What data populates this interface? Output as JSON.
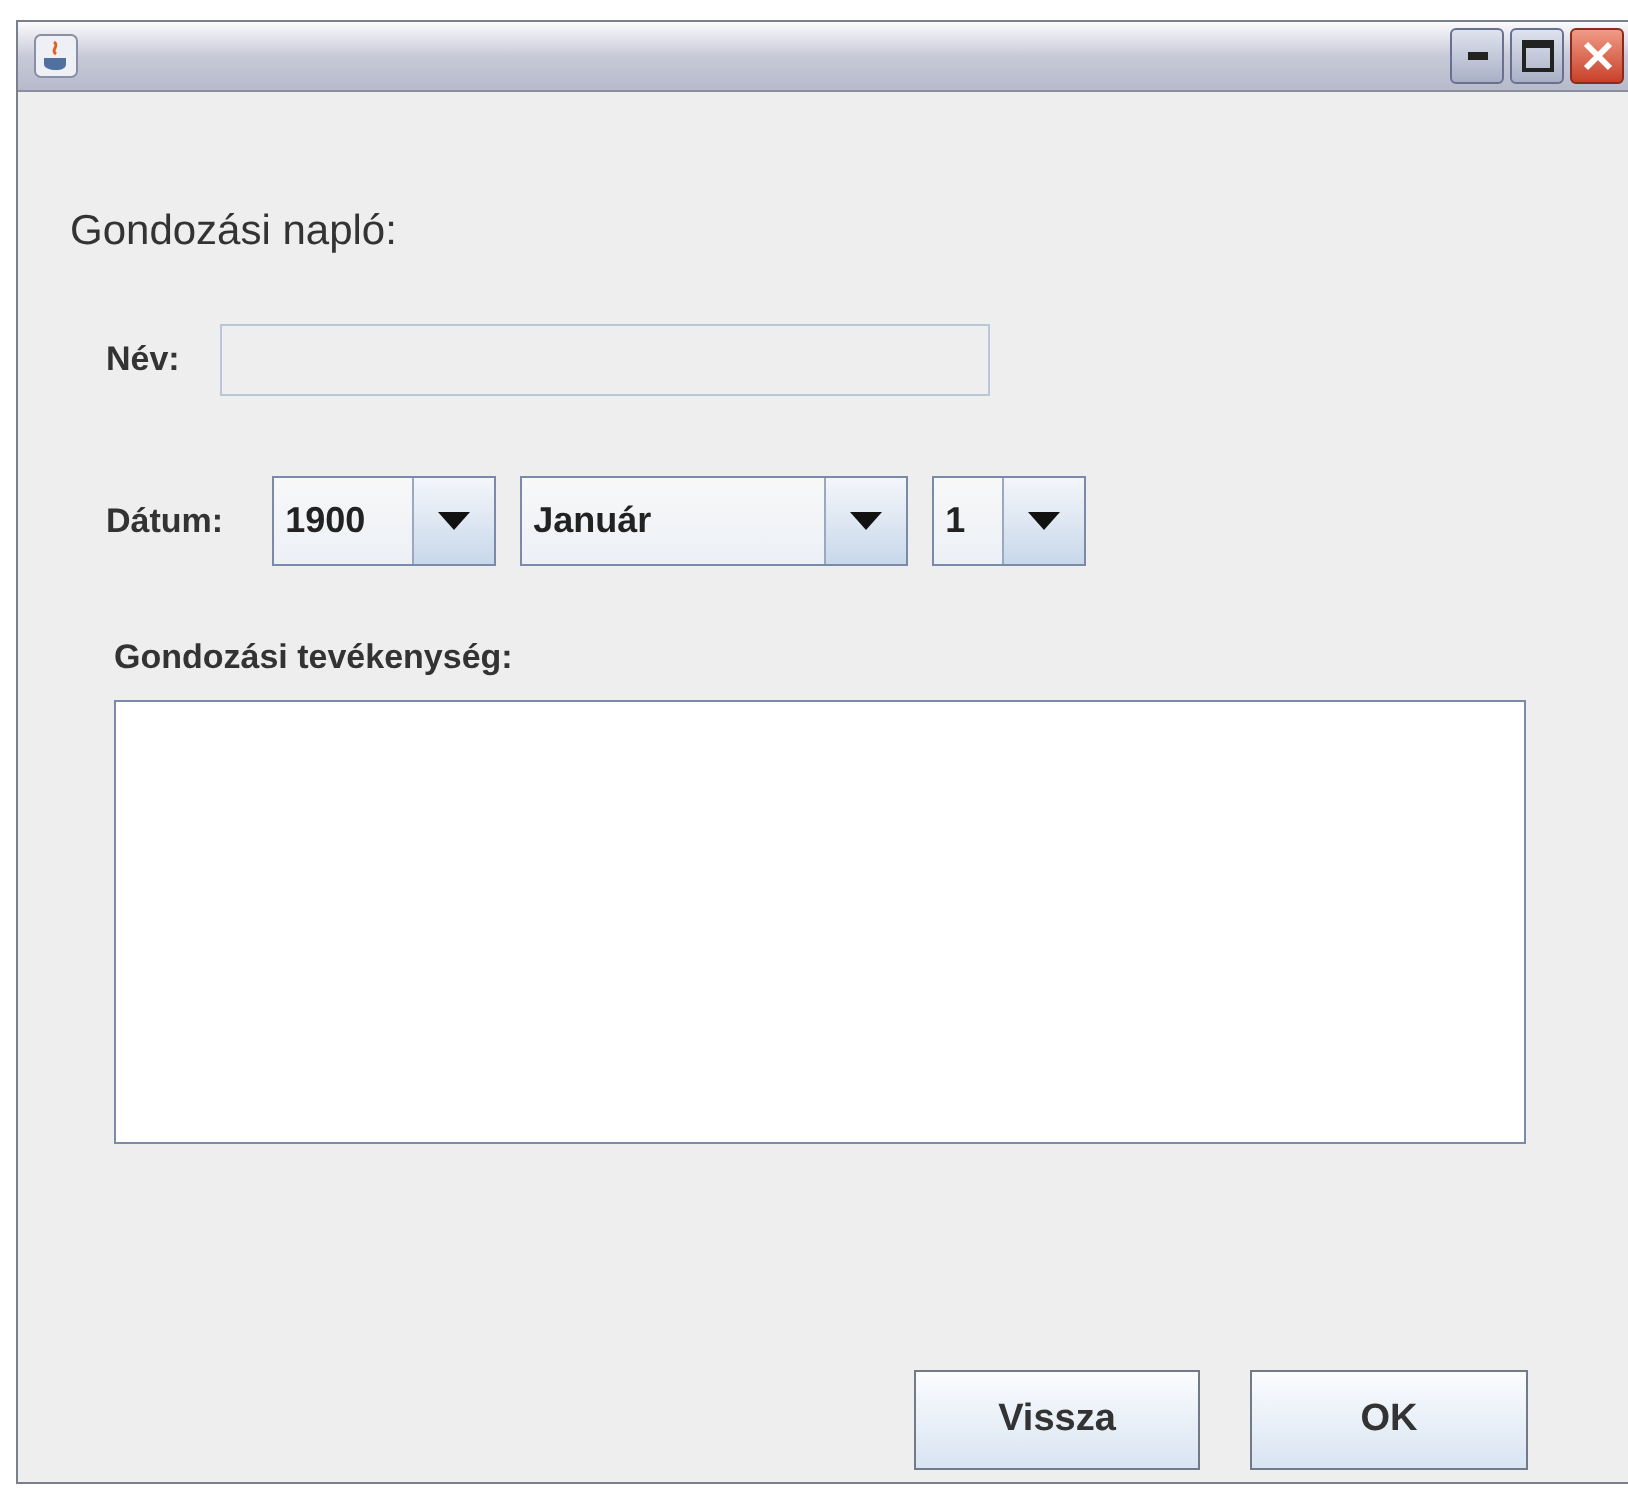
{
  "window": {
    "title_buttons": [
      {
        "kind": "minimize"
      },
      {
        "kind": "maximize"
      },
      {
        "kind": "close"
      }
    ]
  },
  "heading": "Gondozási napló:",
  "name_field": {
    "label": "Név:",
    "disabled": true
  },
  "date": {
    "label": "Dátum:",
    "combos": [
      {
        "value": "1900"
      },
      {
        "value": "Január"
      },
      {
        "value": "1"
      }
    ]
  },
  "activity": {
    "label": "Gondozási tevékenység:"
  },
  "buttons": [
    "Vissza",
    "OK"
  ]
}
